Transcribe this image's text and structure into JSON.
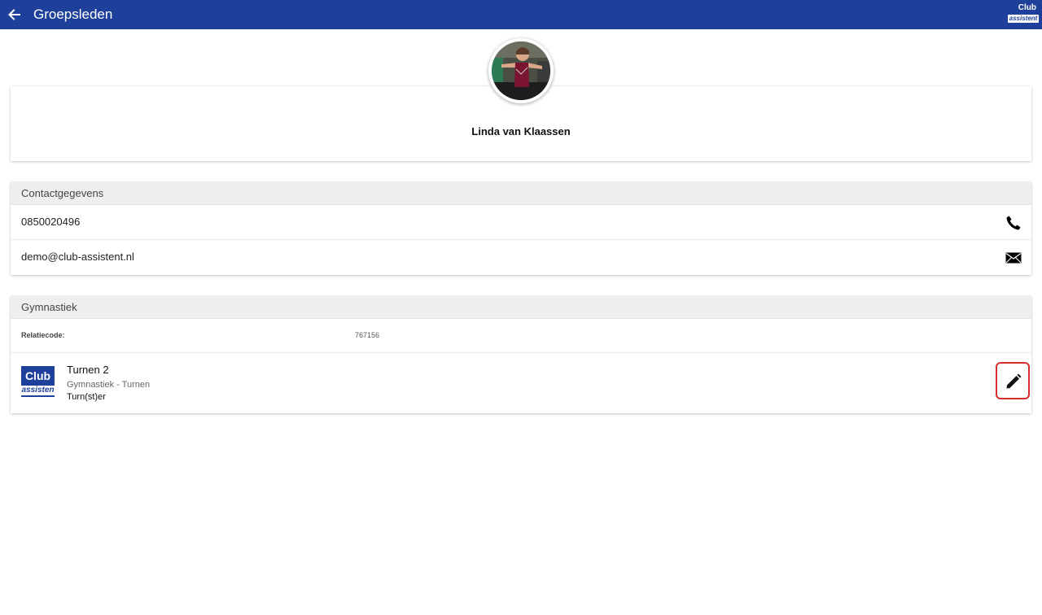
{
  "header": {
    "title": "Groepsleden",
    "logo_club": "Club",
    "logo_assist": "assistent"
  },
  "profile": {
    "name": "Linda van Klaassen"
  },
  "contact": {
    "header": "Contactgegevens",
    "phone": "0850020496",
    "email": "demo@club-assistent.nl"
  },
  "gymnastics": {
    "header": "Gymnastiek",
    "relation_label": "Relatiecode:",
    "relation_value": "767156",
    "group": {
      "logo_top": "Club",
      "logo_bottom": "assisten",
      "title": "Turnen 2",
      "subtitle": "Gymnastiek - Turnen",
      "role": "Turn(st)er"
    }
  },
  "colors": {
    "topbar": "#1e3f9a",
    "highlight": "#d32f2f"
  }
}
